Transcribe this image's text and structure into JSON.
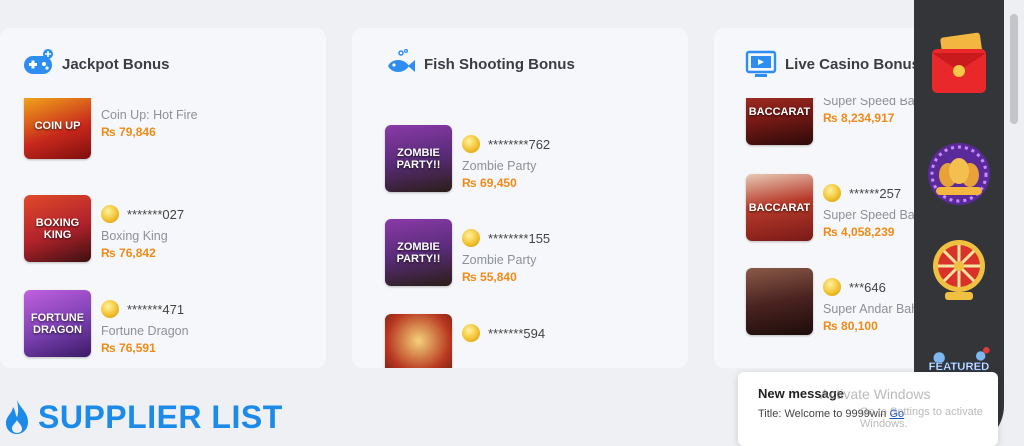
{
  "panels": [
    {
      "title": "Jackpot Bonus",
      "icon": "gamepad-icon",
      "items": [
        {
          "user": "",
          "game": "Coin Up: Hot Fire",
          "amount": "₨ 79,846",
          "thumb_text": "COIN UP",
          "thumb_color": "#c8281c"
        },
        {
          "user": "*******027",
          "game": "Boxing King",
          "amount": "₨ 76,842",
          "thumb_text": "BOXING KING",
          "thumb_color": "#b0222b"
        },
        {
          "user": "*******471",
          "game": "Fortune Dragon",
          "amount": "₨ 76,591",
          "thumb_text": "FORTUNE DRAGON",
          "thumb_color": "#7a3fb0"
        }
      ]
    },
    {
      "title": "Fish Shooting Bonus",
      "icon": "fish-icon",
      "items": [
        {
          "user": "********762",
          "game": "Zombie Party",
          "amount": "₨ 69,450",
          "thumb_text": "ZOMBIE PARTY!!",
          "thumb_color": "#5a2c7a"
        },
        {
          "user": "********155",
          "game": "Zombie Party",
          "amount": "₨ 55,840",
          "thumb_text": "ZOMBIE PARTY!!",
          "thumb_color": "#5a2c7a"
        },
        {
          "user": "*******594",
          "game": "",
          "amount": "",
          "thumb_text": "",
          "thumb_color": "#b8361f"
        }
      ]
    },
    {
      "title": "Live Casino Bonus",
      "icon": "live-tv-icon",
      "items": [
        {
          "user": "",
          "game": "Super Speed Baccarat A",
          "amount": "₨ 8,234,917",
          "thumb_text": "BACCARAT",
          "thumb_color": "#7a1a16"
        },
        {
          "user": "******257",
          "game": "Super Speed Baccarat A",
          "amount": "₨ 4,058,239",
          "thumb_text": "BACCARAT",
          "thumb_color": "#7a1a16"
        },
        {
          "user": "***646",
          "game": "Super Andar Bahar",
          "amount": "₨ 80,100",
          "thumb_text": "",
          "thumb_color": "#4a2320"
        }
      ]
    }
  ],
  "supplier": {
    "title": "SUPPLIER LIST",
    "icon": "fire-icon"
  },
  "side_rail": [
    {
      "icon": "red-envelope-icon"
    },
    {
      "icon": "golden-eggs-icon"
    },
    {
      "icon": "lucky-wheel-icon"
    },
    {
      "icon": "featured-games-icon",
      "label": "FEATURED GAMES"
    }
  ],
  "toast": {
    "title": "New message",
    "body": "Title: Welcome to 9999win",
    "link": "Go"
  },
  "watermark": {
    "line1": "Activate Windows",
    "line2": "Go to Settings to activate Windows."
  },
  "colors": {
    "accent": "#1c8ae8",
    "amount": "#f08a16",
    "rail": "#333538"
  }
}
